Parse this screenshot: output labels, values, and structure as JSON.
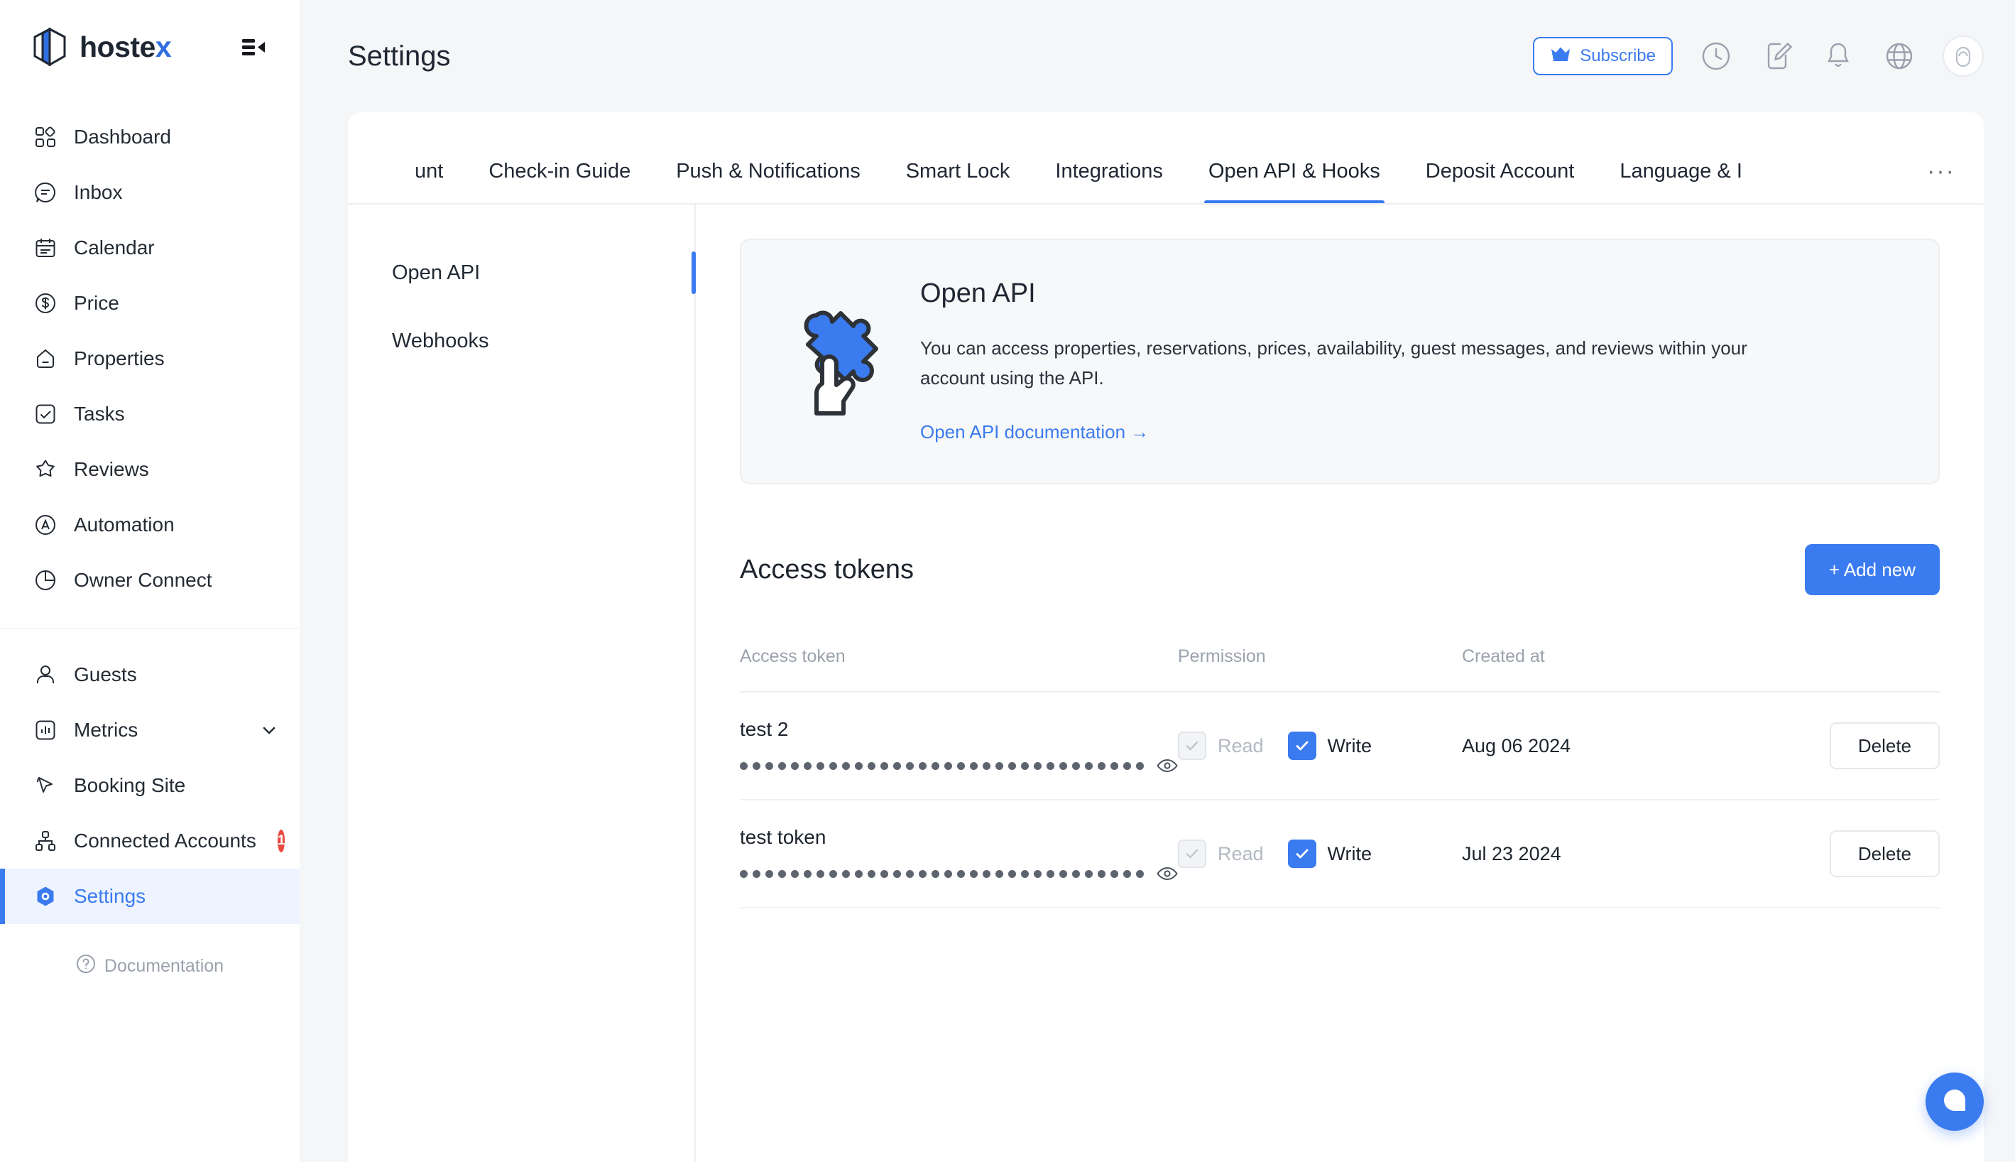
{
  "brand": {
    "name": "hostex",
    "name_main": "hoste",
    "name_accent": "x",
    "collapse_icon": "collapse-sidebar-icon"
  },
  "sidebar": {
    "group1": [
      {
        "label": "Dashboard",
        "icon": "dashboard-icon"
      },
      {
        "label": "Inbox",
        "icon": "inbox-icon"
      },
      {
        "label": "Calendar",
        "icon": "calendar-icon"
      },
      {
        "label": "Price",
        "icon": "price-dollar-icon"
      },
      {
        "label": "Properties",
        "icon": "home-icon"
      },
      {
        "label": "Tasks",
        "icon": "checkbox-icon"
      },
      {
        "label": "Reviews",
        "icon": "star-icon"
      },
      {
        "label": "Automation",
        "icon": "automation-a-icon"
      },
      {
        "label": "Owner Connect",
        "icon": "pie-chart-icon"
      }
    ],
    "group2": [
      {
        "label": "Guests",
        "icon": "user-icon",
        "badge": "",
        "chevron": false
      },
      {
        "label": "Metrics",
        "icon": "bar-chart-icon",
        "badge": "",
        "chevron": true
      },
      {
        "label": "Booking Site",
        "icon": "cursor-icon",
        "badge": "",
        "chevron": false
      },
      {
        "label": "Connected Accounts",
        "icon": "sitemap-icon",
        "badge": "1",
        "chevron": false
      },
      {
        "label": "Settings",
        "icon": "settings-hex-icon",
        "badge": "",
        "chevron": false,
        "active": true
      }
    ],
    "documentation": {
      "label": "Documentation",
      "icon": "question-circle-icon"
    }
  },
  "topbar": {
    "title": "Settings",
    "subscribe_label": "Subscribe",
    "subscribe_icon": "crown-icon",
    "icons": [
      {
        "name": "history-clock-icon"
      },
      {
        "name": "edit-note-icon"
      },
      {
        "name": "bell-icon"
      },
      {
        "name": "globe-icon"
      }
    ],
    "avatar": "user-avatar"
  },
  "tabs": {
    "items": [
      {
        "label": "unt",
        "active": false
      },
      {
        "label": "Check-in Guide",
        "active": false
      },
      {
        "label": "Push & Notifications",
        "active": false
      },
      {
        "label": "Smart Lock",
        "active": false
      },
      {
        "label": "Integrations",
        "active": false
      },
      {
        "label": "Open API & Hooks",
        "active": true
      },
      {
        "label": "Deposit Account",
        "active": false
      },
      {
        "label": "Language & I",
        "active": false
      }
    ],
    "more_label": "···"
  },
  "subnav": {
    "items": [
      {
        "label": "Open API",
        "active": true
      },
      {
        "label": "Webhooks",
        "active": false
      }
    ]
  },
  "api_card": {
    "illustration": "puzzle-hand-icon",
    "title": "Open API",
    "description": "You can access properties, reservations, prices, availability, guest messages, and reviews within your account using the API.",
    "link_label": "Open API documentation →"
  },
  "access_tokens": {
    "title": "Access tokens",
    "add_new_label": "+ Add new",
    "columns": [
      "Access token",
      "Permission",
      "Created at",
      ""
    ],
    "masked_dot_count": 32,
    "eye_icon": "eye-icon",
    "rows": [
      {
        "name": "test 2",
        "token_masked": "••••••••••••••••••••••••••••••••",
        "read_label": "Read",
        "read_checked": true,
        "read_disabled": true,
        "write_label": "Write",
        "write_checked": true,
        "created_at": "Aug 06 2024",
        "delete_label": "Delete"
      },
      {
        "name": "test token",
        "token_masked": "••••••••••••••••••••••••••••••••",
        "read_label": "Read",
        "read_checked": true,
        "read_disabled": true,
        "write_label": "Write",
        "write_checked": true,
        "created_at": "Jul 23 2024",
        "delete_label": "Delete"
      }
    ]
  },
  "chat_widget": {
    "icon": "chat-bubble-icon"
  },
  "colors": {
    "accent": "#3b7bf0",
    "badge_red": "#e8483f",
    "page_bg": "#f5f6f8",
    "card_bg": "#ffffff",
    "panel_bg": "#f7f8f9",
    "muted_text": "#9ba2ac"
  }
}
